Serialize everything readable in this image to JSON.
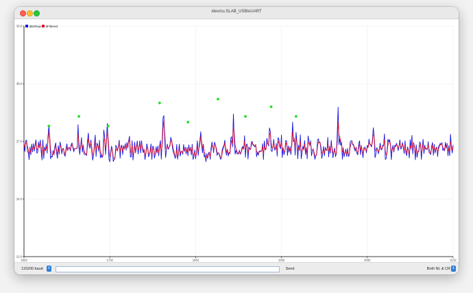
{
  "window": {
    "title": "/dev/cu.SLAB_USBtoUART"
  },
  "colors": {
    "raw": "#1010e0",
    "filtered": "#e0102c",
    "peak": "#22dd22",
    "grid": "#e8e8e8",
    "axis": "#000000"
  },
  "bottom": {
    "baud": "115200 baud",
    "send": "Send",
    "line_ending": "Both NL & CR",
    "message_value": "",
    "stepper_glyph": "⇕"
  },
  "chart_data": {
    "type": "line",
    "legend": [
      "dBSRaw",
      "dFiltered"
    ],
    "legend_position": "top-left",
    "grid": true,
    "xlim": [
      1632,
      2132
    ],
    "ylim": [
      21.0,
      33.0
    ],
    "x_ticks": [
      1632,
      1732,
      1832,
      1932,
      2032,
      2132
    ],
    "y_ticks": [
      21.0,
      24.0,
      27.0,
      30.0,
      33.0
    ],
    "peaks": [
      {
        "x": 1661,
        "y": 27.8
      },
      {
        "x": 1696,
        "y": 28.3
      },
      {
        "x": 1730,
        "y": 27.8
      },
      {
        "x": 1790,
        "y": 29.0
      },
      {
        "x": 1823,
        "y": 28.0
      },
      {
        "x": 1858,
        "y": 29.2
      },
      {
        "x": 1890,
        "y": 28.3
      },
      {
        "x": 1920,
        "y": 28.8
      },
      {
        "x": 1949,
        "y": 28.3
      }
    ],
    "series": [
      {
        "name": "dBSRaw",
        "values": [
          26.96,
          26.47,
          27.03,
          27.07,
          26.49,
          26.41,
          26.05,
          26.71,
          26.3,
          26.86,
          26.45,
          26.88,
          26.49,
          26.84,
          27.08,
          26.38,
          26.45,
          26.97,
          26.66,
          27.07,
          26.48,
          26.03,
          27.08,
          26.1,
          26.71,
          26.5,
          26.87,
          26.38,
          27.27,
          27.81,
          27.07,
          26.09,
          26.24,
          26.19,
          26.54,
          26.29,
          26.74,
          26.92,
          26.4,
          26.11,
          26.78,
          26.33,
          26.96,
          26.78,
          26.35,
          26.61,
          26.63,
          26.3,
          26.22,
          26.63,
          26.87,
          26.52,
          26.68,
          26.68,
          26.5,
          26.84,
          26.92,
          26.65,
          26.46,
          26.63,
          26.61,
          26.65,
          26.64,
          27.87,
          26.65,
          26.32,
          26.76,
          27.2,
          26.44,
          26.82,
          26.33,
          26.31,
          26.34,
          26.26,
          27.04,
          27.43,
          26.75,
          26.64,
          27.07,
          26.49,
          26.02,
          26.25,
          26.82,
          27.33,
          26.21,
          26.91,
          26.8,
          26.49,
          27.05,
          26.14,
          26.29,
          26.16,
          26.24,
          27.59,
          27.21,
          26.32,
          27.0,
          27.93,
          27.04,
          26.08,
          25.94,
          26.41,
          26.75,
          26.56,
          25.95,
          26.06,
          26.12,
          26.8,
          26.7,
          26.5,
          26.75,
          27.06,
          26.12,
          26.75,
          26.8,
          26.31,
          26.77,
          26.6,
          26.88,
          26.54,
          26.95,
          26.65,
          27.05,
          27.27,
          26.18,
          26.21,
          27.04,
          26.03,
          26.46,
          26.96,
          26.4,
          26.72,
          27.02,
          26.34,
          26.71,
          27.03,
          26.4,
          27.03,
          26.61,
          26.41,
          26.58,
          26.05,
          26.38,
          26.87,
          26.74,
          26.2,
          26.27,
          26.52,
          26.87,
          26.06,
          26.75,
          26.72,
          26.13,
          26.33,
          26.72,
          26.39,
          26.76,
          26.25,
          26.77,
          27.04,
          26.07,
          27.0,
          28.22,
          28.34,
          27.06,
          26.16,
          26.57,
          26.86,
          26.58,
          26.68,
          26.81,
          27.21,
          27.06,
          26.67,
          26.42,
          26.32,
          26.12,
          26.17,
          26.84,
          26.07,
          26.41,
          26.86,
          26.23,
          26.48,
          26.48,
          26.33,
          26.84,
          26.47,
          26.7,
          26.34,
          26.69,
          26.25,
          26.82,
          26.49,
          26.69,
          26.29,
          26.85,
          26.06,
          26.21,
          26.55,
          26.09,
          26.46,
          27.03,
          26.26,
          26.75,
          27.06,
          27.5,
          26.8,
          26.4,
          26.86,
          26.18,
          26.3,
          25.94,
          26.36,
          26.11,
          26.39,
          26.44,
          26.06,
          26.68,
          26.96,
          26.77,
          26.41,
          26.96,
          26.82,
          26.56,
          26.27,
          26.39,
          26.37,
          26.24,
          26.06,
          26.14,
          26.59,
          26.72,
          26.79,
          27.06,
          26.49,
          26.28,
          26.59,
          26.24,
          26.43,
          26.35,
          27.17,
          27.24,
          26.71,
          28.42,
          27.09,
          26.33,
          26.54,
          26.36,
          26.36,
          26.34,
          26.54,
          26.33,
          26.44,
          26.66,
          26.74,
          26.59,
          27.29,
          26.17,
          26.85,
          26.86,
          26.08,
          26.71,
          26.62,
          26.57,
          26.98,
          26.99,
          26.78,
          26.8,
          26.71,
          26.84,
          26.2,
          26.43,
          26.28,
          26.49,
          26.5,
          26.5,
          26.48,
          26.88,
          26.05,
          27.02,
          26.55,
          26.59,
          27.16,
          26.9,
          26.75,
          27.7,
          27.52,
          26.53,
          26.47,
          26.65,
          27.11,
          26.56,
          26.56,
          26.89,
          26.23,
          27.19,
          27.12,
          26.71,
          26.62,
          27.33,
          26.16,
          26.67,
          26.31,
          26.51,
          27.05,
          27.02,
          26.26,
          26.76,
          26.44,
          26.72,
          26.31,
          26.93,
          28.0,
          26.98,
          27.11,
          26.28,
          27.47,
          26.93,
          26.09,
          26.81,
          26.52,
          27.34,
          26.09,
          26.44,
          26.76,
          26.56,
          27.04,
          26.32,
          26.69,
          26.09,
          27.28,
          27.03,
          26.77,
          27.03,
          26.25,
          26.51,
          26.61,
          26.3,
          26.07,
          26.24,
          26.36,
          27.04,
          27.14,
          26.92,
          26.96,
          26.55,
          26.11,
          26.37,
          26.74,
          26.25,
          26.69,
          26.55,
          26.51,
          27.21,
          26.19,
          26.75,
          26.38,
          27.05,
          26.56,
          26.15,
          26.43,
          26.65,
          26.2,
          26.39,
          27.4,
          28.78,
          26.83,
          27.16,
          26.79,
          26.94,
          26.07,
          26.67,
          26.2,
          26.39,
          26.59,
          26.21,
          26.63,
          26.21,
          26.29,
          26.95,
          27.03,
          27.04,
          26.82,
          26.8,
          26.59,
          26.49,
          26.7,
          26.36,
          26.3,
          26.88,
          27.03,
          26.31,
          26.79,
          26.49,
          26.15,
          26.66,
          26.71,
          26.61,
          26.41,
          26.8,
          26.68,
          27.12,
          26.84,
          26.79,
          26.71,
          27.08,
          27.71,
          27.28,
          26.15,
          26.33,
          26.67,
          26.58,
          26.35,
          26.61,
          26.91,
          26.57,
          26.56,
          26.81,
          26.79,
          27.39,
          26.06,
          26.1,
          26.47,
          27.11,
          26.97,
          27.1,
          26.79,
          26.05,
          26.61,
          26.79,
          26.44,
          26.8,
          26.75,
          26.9,
          26.78,
          26.52,
          26.76,
          27.08,
          26.6,
          26.64,
          26.94,
          26.69,
          26.36,
          27.03,
          26.37,
          26.26,
          26.71,
          26.52,
          26.13,
          27.09,
          26.6,
          27.31,
          26.34,
          26.94,
          26.71,
          26.04,
          26.82,
          26.17,
          26.49,
          26.51,
          26.97,
          26.89,
          26.06,
          26.62,
          27.11,
          26.36,
          26.8,
          26.59,
          26.62,
          26.57,
          26.98,
          26.42,
          26.37,
          26.32,
          26.76,
          26.94,
          26.28,
          26.84,
          26.39,
          26.63,
          26.7,
          26.21,
          26.73,
          26.8,
          26.9,
          26.82,
          26.94,
          26.53,
          26.62,
          26.5,
          26.95,
          26.64,
          26.9,
          26.25,
          26.78,
          26.25,
          27.37,
          26.66,
          26.39,
          26.81
        ]
      },
      {
        "name": "dFiltered",
        "values": [
          26.9,
          26.68,
          26.87,
          26.96,
          26.73,
          26.58,
          26.34,
          26.55,
          26.42,
          26.67,
          26.57,
          26.75,
          26.61,
          26.74,
          26.93,
          26.62,
          26.54,
          26.79,
          26.72,
          26.92,
          26.66,
          26.3,
          26.76,
          26.38,
          26.58,
          26.54,
          26.73,
          26.53,
          27.03,
          27.48,
          27.25,
          26.57,
          26.38,
          26.27,
          26.43,
          26.35,
          26.58,
          26.78,
          26.57,
          26.3,
          26.58,
          26.44,
          26.74,
          26.76,
          26.52,
          26.57,
          26.6,
          26.42,
          26.3,
          26.49,
          26.71,
          26.6,
          26.65,
          26.67,
          26.57,
          26.73,
          26.84,
          26.73,
          26.57,
          26.61,
          26.61,
          26.63,
          26.64,
          27.37,
          26.95,
          26.58,
          26.69,
          27.0,
          26.68,
          26.76,
          26.51,
          26.39,
          26.36,
          26.3,
          26.73,
          27.14,
          26.91,
          26.75,
          26.95,
          26.68,
          26.29,
          26.27,
          26.6,
          27.03,
          26.56,
          26.77,
          26.79,
          26.61,
          26.88,
          26.45,
          26.36,
          26.24,
          26.24,
          27.02,
          27.13,
          26.65,
          26.87,
          27.51,
          27.22,
          26.56,
          26.2,
          26.33,
          26.59,
          26.57,
          26.2,
          26.11,
          26.12,
          26.5,
          26.62,
          26.55,
          26.68,
          26.92,
          26.46,
          26.64,
          26.74,
          26.49,
          26.66,
          26.62,
          26.78,
          26.64,
          26.83,
          26.73,
          26.93,
          27.14,
          26.6,
          26.36,
          26.78,
          26.3,
          26.4,
          26.75,
          26.55,
          26.66,
          26.88,
          26.55,
          26.65,
          26.89,
          26.6,
          26.87,
          26.72,
          26.54,
          26.57,
          26.27,
          26.33,
          26.64,
          26.7,
          26.4,
          26.32,
          26.44,
          26.7,
          26.32,
          26.58,
          26.66,
          26.34,
          26.34,
          26.57,
          26.46,
          26.64,
          26.4,
          26.63,
          26.87,
          26.41,
          26.76,
          27.65,
          28.09,
          27.47,
          26.68,
          26.6,
          26.76,
          26.65,
          26.67,
          26.76,
          27.04,
          27.05,
          26.83,
          26.6,
          26.44,
          26.25,
          26.2,
          26.57,
          26.28,
          26.36,
          26.65,
          26.4,
          26.45,
          26.47,
          26.39,
          26.66,
          26.54,
          26.64,
          26.46,
          26.6,
          26.4,
          26.65,
          26.56,
          26.64,
          26.43,
          26.7,
          26.32,
          26.26,
          26.43,
          26.23,
          26.36,
          26.77,
          26.48,
          26.64,
          26.9,
          27.25,
          27.0,
          26.66,
          26.78,
          26.43,
          26.36,
          26.1,
          26.25,
          26.17,
          26.3,
          26.39,
          26.2,
          26.49,
          26.77,
          26.77,
          26.57,
          26.8,
          26.81,
          26.66,
          26.43,
          26.41,
          26.39,
          26.3,
          26.16,
          26.15,
          26.4,
          26.6,
          26.71,
          26.92,
          26.67,
          26.44,
          26.53,
          26.36,
          26.4,
          26.37,
          26.83,
          27.07,
          26.86,
          27.8,
          27.4,
          26.78,
          26.64,
          26.48,
          26.41,
          26.37,
          26.47,
          26.39,
          26.42,
          26.56,
          26.67,
          26.62,
          27.02,
          26.55,
          26.73,
          26.81,
          26.4,
          26.58,
          26.6,
          26.58,
          26.82,
          26.92,
          26.84,
          26.81,
          26.75,
          26.8,
          26.46,
          26.45,
          26.36,
          26.43,
          26.47,
          26.49,
          26.48,
          26.72,
          26.32,
          26.74,
          26.63,
          26.6,
          26.93,
          26.91,
          26.81,
          27.34,
          27.45,
          26.93,
          26.67,
          26.66,
          26.93,
          26.7,
          26.62,
          26.78,
          26.45,
          26.88,
          27.02,
          26.84,
          26.71,
          27.07,
          26.55,
          26.62,
          26.44,
          26.48,
          26.82,
          26.94,
          26.54,
          26.67,
          26.54,
          26.65,
          26.46,
          26.73,
          27.5,
          27.2,
          27.15,
          26.66,
          27.13,
          27.01,
          26.49,
          26.68,
          26.59,
          27.02,
          26.51,
          26.47,
          26.64,
          26.59,
          26.85,
          26.55,
          26.63,
          26.32,
          26.86,
          26.96,
          26.85,
          26.95,
          26.55,
          26.53,
          26.58,
          26.42,
          26.22,
          26.23,
          26.31,
          26.73,
          26.97,
          26.94,
          26.95,
          26.73,
          26.38,
          26.37,
          26.59,
          26.4,
          26.56,
          26.55,
          26.53,
          26.91,
          26.5,
          26.64,
          26.49,
          26.81,
          26.67,
          26.38,
          26.41,
          26.55,
          26.35,
          26.37,
          26.94,
          27.98,
          27.33,
          27.23,
          26.98,
          26.96,
          26.46,
          26.58,
          26.37,
          26.38,
          26.5,
          26.34,
          26.5,
          26.34,
          26.31,
          26.67,
          26.87,
          26.97,
          26.88,
          26.83,
          26.69,
          26.58,
          26.65,
          26.48,
          26.38,
          26.66,
          26.88,
          26.56,
          26.7,
          26.58,
          26.34,
          26.52,
          26.63,
          26.62,
          26.5,
          26.68,
          26.68,
          26.93,
          26.88,
          26.83,
          26.76,
          26.94,
          27.37,
          27.32,
          26.66,
          26.48,
          26.59,
          26.58,
          26.45,
          26.54,
          26.76,
          26.65,
          26.6,
          26.72,
          26.76,
          27.11,
          26.52,
          26.28,
          26.39,
          26.8,
          26.9,
          27.01,
          26.89,
          26.41,
          26.53,
          26.68,
          26.54,
          26.69,
          26.72,
          26.83,
          26.8,
          26.64,
          26.71,
          26.93,
          26.74,
          26.68,
          26.84,
          26.75,
          26.52,
          26.82,
          26.57,
          26.39,
          26.58,
          26.55,
          26.3,
          26.75,
          26.66,
          27.04,
          26.64,
          26.82,
          26.75,
          26.34,
          26.62,
          26.36,
          26.44,
          26.48,
          26.77,
          26.84,
          26.39,
          26.53,
          26.88,
          26.58,
          26.71,
          26.64,
          26.63,
          26.6,
          26.82,
          26.59,
          26.46,
          26.38,
          26.6,
          26.8,
          26.5,
          26.7,
          26.52,
          26.59,
          26.66,
          26.4,
          26.6,
          26.72,
          26.83,
          26.82,
          26.89,
          26.68,
          26.64,
          26.56,
          26.79,
          26.7,
          26.82,
          26.49,
          26.66,
          26.42,
          26.98,
          26.8,
          26.56,
          26.71
        ]
      }
    ]
  }
}
